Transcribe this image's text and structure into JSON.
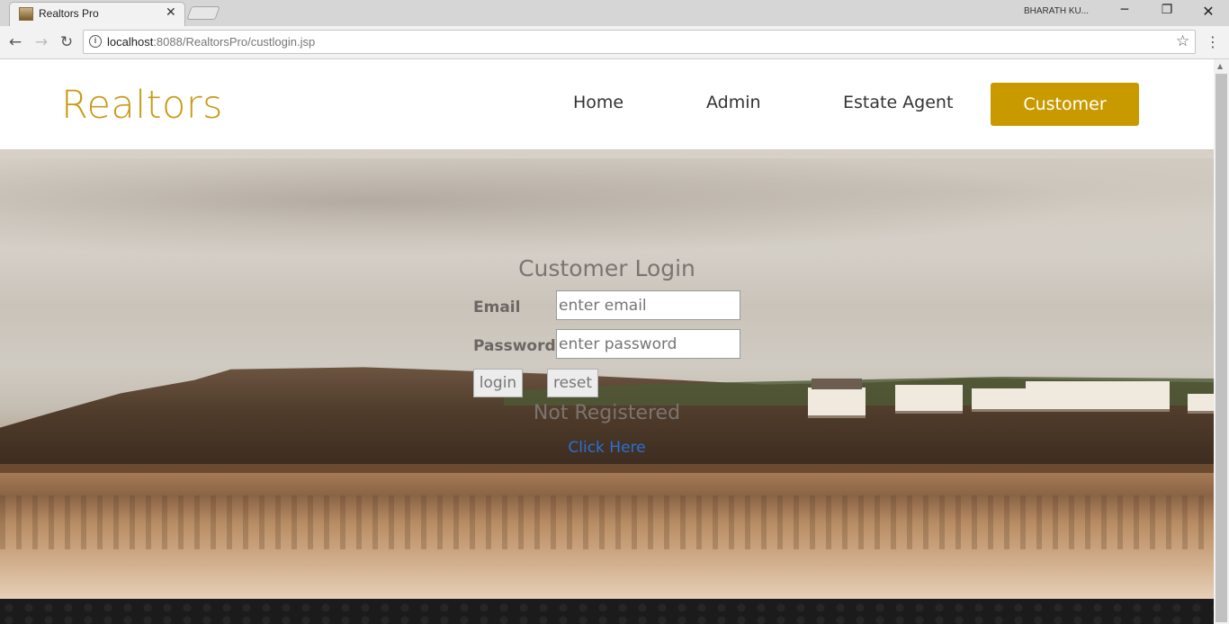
{
  "browser": {
    "tab_title": "Realtors Pro",
    "tab_close": "✕",
    "profile_name": "BHARATH KU...",
    "url_host": "localhost",
    "url_rest": ":8088/RealtorsPro/custlogin.jsp"
  },
  "header": {
    "logo": "Realtors",
    "nav": {
      "home": "Home",
      "admin": "Admin",
      "agent": "Estate Agent",
      "customer": "Customer"
    },
    "accent_color": "#c99a00"
  },
  "login": {
    "title": "Customer Login",
    "email_label": "Email",
    "email_placeholder": "enter email",
    "password_label": "Password",
    "password_placeholder": "enter password",
    "login_button": "login",
    "reset_button": "reset",
    "not_registered": "Not Registered",
    "click_here": "Click Here"
  }
}
